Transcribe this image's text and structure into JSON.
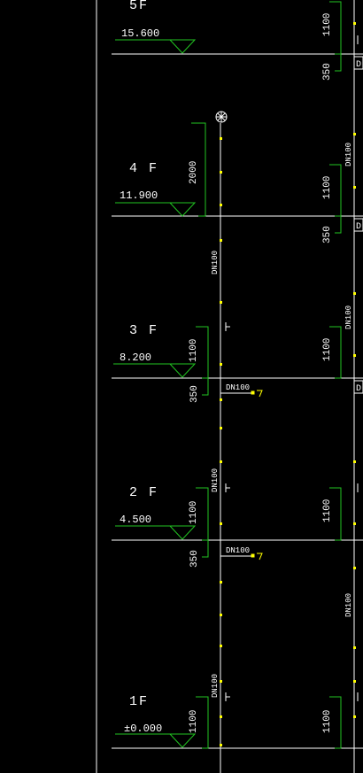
{
  "colors": {
    "background": "#000000",
    "pipe": "#ffffff",
    "floor_line": "#ffffff",
    "dimension": "#22c522",
    "marker": "#ffff00"
  },
  "floors": [
    {
      "label": "5F",
      "elevation": "15.600"
    },
    {
      "label": "4 F",
      "elevation": "11.900"
    },
    {
      "label": "3 F",
      "elevation": "8.200"
    },
    {
      "label": "2 F",
      "elevation": "4.500"
    },
    {
      "label": "1F",
      "elevation": "±0.000"
    }
  ],
  "dimensions": {
    "d1100": "1100",
    "d350": "350",
    "d2000": "2000"
  },
  "pipe_labels": {
    "dn100": "DN100",
    "d_cut": "D"
  },
  "icons": {
    "vent_cap": "vent-cap-icon",
    "valve": "valve-marker-icon"
  }
}
